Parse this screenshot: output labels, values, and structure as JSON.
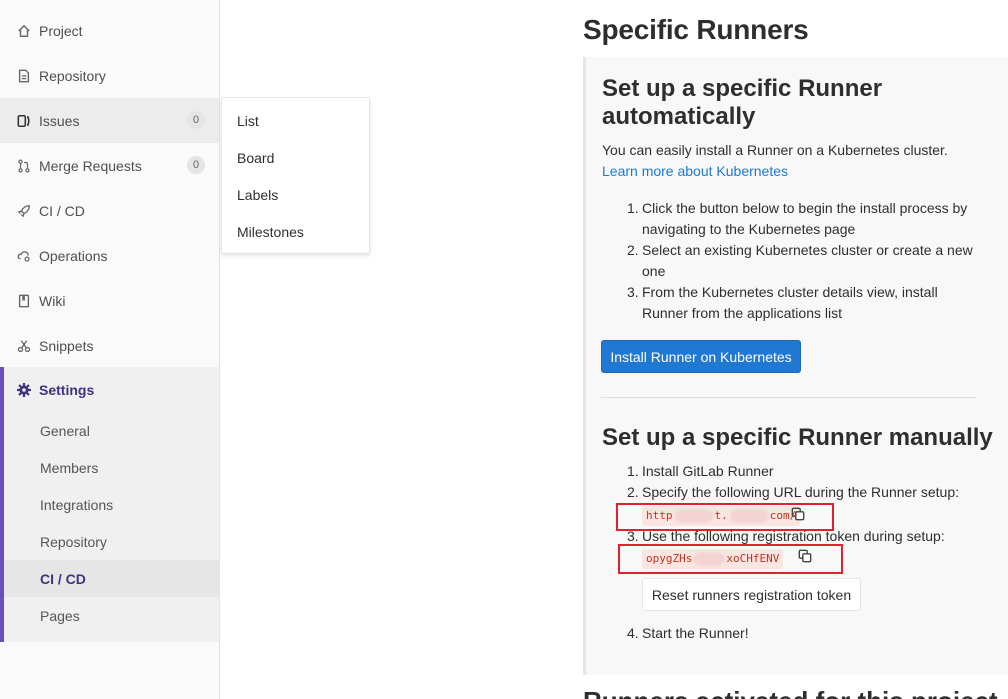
{
  "sidebar": {
    "items": [
      {
        "label": "Project",
        "icon": "home-icon"
      },
      {
        "label": "Repository",
        "icon": "doc-icon"
      },
      {
        "label": "Issues",
        "icon": "issues-icon",
        "badge": "0"
      },
      {
        "label": "Merge Requests",
        "icon": "merge-request-icon",
        "badge": "0"
      },
      {
        "label": "CI / CD",
        "icon": "rocket-icon"
      },
      {
        "label": "Operations",
        "icon": "cloud-gear-icon"
      },
      {
        "label": "Wiki",
        "icon": "book-icon"
      },
      {
        "label": "Snippets",
        "icon": "scissors-icon"
      }
    ],
    "settings": {
      "label": "Settings",
      "icon": "gear-icon",
      "sub_items": [
        "General",
        "Members",
        "Integrations",
        "Repository",
        "CI / CD",
        "Pages"
      ],
      "current": "CI / CD"
    }
  },
  "issues_dropdown": {
    "items": [
      "List",
      "Board",
      "Labels",
      "Milestones"
    ]
  },
  "main": {
    "title": "Specific Runners",
    "auto": {
      "heading_line1": "Set up a specific Runner",
      "heading_line2": "automatically",
      "intro": "You can easily install a Runner on a Kubernetes cluster.",
      "learn_more": "Learn more about Kubernetes",
      "steps": [
        {
          "num": "1.",
          "line1": "Click the button below to begin the install process by",
          "line2": "navigating to the Kubernetes page"
        },
        {
          "num": "2.",
          "line1": "Select an existing Kubernetes cluster or create a new",
          "line2": "one"
        },
        {
          "num": "3.",
          "line1": "From the Kubernetes cluster details view, install",
          "line2": "Runner from the applications list"
        }
      ],
      "install_button": "Install Runner on Kubernetes"
    },
    "manual": {
      "heading": "Set up a specific Runner manually",
      "step1_num": "1.",
      "step1_link": "Install GitLab Runner",
      "step2_num": "2.",
      "step2_text": "Specify the following URL during the Runner setup:",
      "url_start": "http",
      "url_mid": "t.",
      "url_end": "com/",
      "step3_num": "3.",
      "step3_text": "Use the following registration token during setup:",
      "token_start": "opygZHs",
      "token_end": "xoCHfENV",
      "reset_button": "Reset runners registration token",
      "step4_num": "4.",
      "step4_text": "Start the Runner!"
    },
    "next_heading": "Runners activated for this project"
  },
  "colors": {
    "accent_purple": "#6b4fbb",
    "primary_blue": "#1f78d1",
    "highlight_red": "#e2202f",
    "code_red": "#c0341d"
  }
}
